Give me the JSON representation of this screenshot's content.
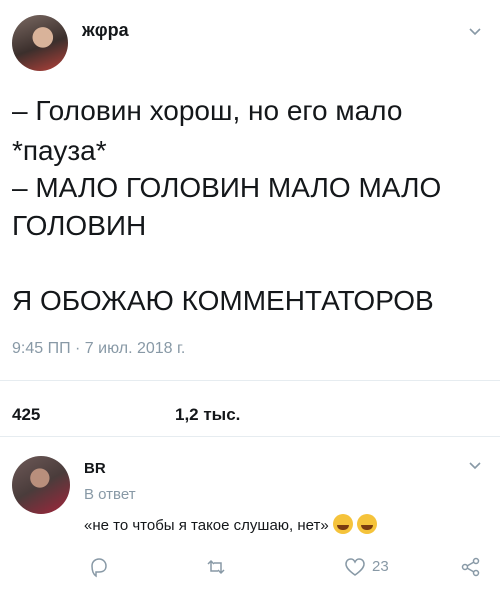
{
  "tweet": {
    "author": "жφра",
    "lines": [
      "– Головин хорош, но его мало",
      "*пауза*",
      "– МАЛО ГОЛОВИН МАЛО МАЛО",
      "ГОЛОВИН",
      "Я ОБОЖАЮ КОММЕНТАТОРОВ"
    ],
    "timestamp": "9:45 ПП · 7 июл. 2018 г.",
    "retweets": "425",
    "likes": "1,2 тыс."
  },
  "reply": {
    "author": "BR",
    "reply_to": "В ответ",
    "text": "«не то чтобы я такое слушаю, нет»",
    "emoji": [
      "face-with-tears-of-joy",
      "face-with-tears-of-joy"
    ],
    "like_count": "23"
  },
  "icons": [
    "chevron-down-icon",
    "reply-icon",
    "retweet-icon",
    "heart-icon",
    "share-icon"
  ],
  "colors": {
    "text": "#14171a",
    "secondary": "#8899a6",
    "divider": "#e6ecf0"
  }
}
